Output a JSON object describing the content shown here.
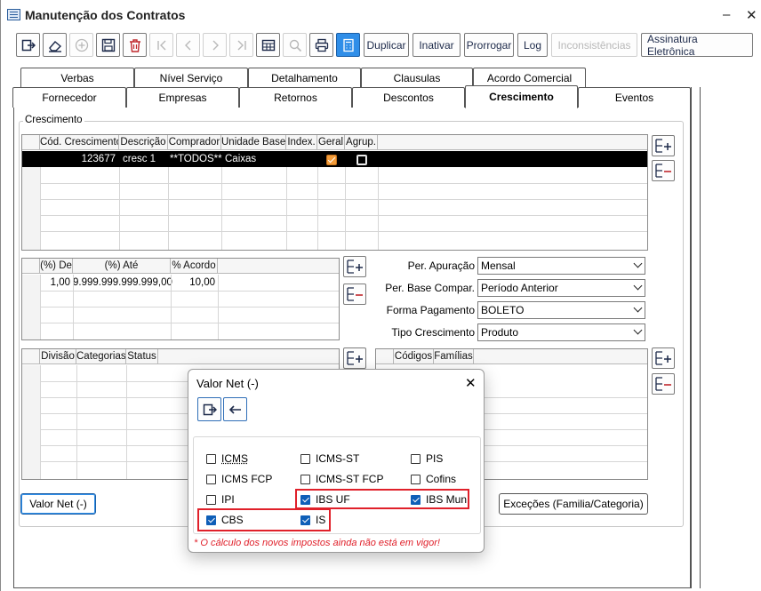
{
  "window": {
    "title": "Manutenção dos Contratos",
    "minimize": "–",
    "close": "✕"
  },
  "toolbar": {
    "buttons": [
      "Duplicar",
      "Inativar",
      "Prorrogar",
      "Log",
      "Inconsistências",
      "Assinatura Eletrônica"
    ]
  },
  "tabs_top": [
    "Verbas",
    "Nível Serviço",
    "Detalhamento",
    "Clausulas",
    "Acordo Comercial"
  ],
  "tabs_bottom": [
    "Fornecedor",
    "Empresas",
    "Retornos",
    "Descontos",
    "Crescimento",
    "Eventos"
  ],
  "crescimento": {
    "group_label": "Crescimento",
    "columns": [
      "Cód. Crescimento",
      "Descrição",
      "Comprador",
      "Unidade Base",
      "Index.",
      "Geral",
      "Agrup."
    ],
    "row": {
      "codigo": "123677",
      "descricao": "cresc 1",
      "comprador": "**TODOS**",
      "unidade": "Caixas"
    }
  },
  "faixas": {
    "columns": [
      "(%) De",
      "(%) Até",
      "% Acordo"
    ],
    "row": {
      "de": "1,00",
      "ate": "9.999.999.999.999,00",
      "acordo": "10,00"
    }
  },
  "form": {
    "per_apuracao_label": "Per. Apuração",
    "per_apuracao": "Mensal",
    "per_base_label": "Per. Base Compar.",
    "per_base": "Período Anterior",
    "forma_pgto_label": "Forma Pagamento",
    "forma_pgto": "BOLETO",
    "tipo_cresc_label": "Tipo Crescimento",
    "tipo_cresc": "Produto"
  },
  "divisao": {
    "columns": [
      "Divisão",
      "Categorias",
      "Status"
    ]
  },
  "familias": {
    "columns": [
      "Códigos",
      "Famílias"
    ]
  },
  "buttons": {
    "valor_net": "Valor Net (-)",
    "excecoes": "Exceções (Familia/Categoria)"
  },
  "dialog": {
    "title": "Valor Net (-)",
    "close": "✕",
    "options": [
      {
        "label": "ICMS",
        "checked": false
      },
      {
        "label": "ICMS-ST",
        "checked": false
      },
      {
        "label": "PIS",
        "checked": false
      },
      {
        "label": "ICMS FCP",
        "checked": false
      },
      {
        "label": "ICMS-ST FCP",
        "checked": false
      },
      {
        "label": "Cofins",
        "checked": false
      },
      {
        "label": "IPI",
        "checked": false
      },
      {
        "label": "IBS UF",
        "checked": true
      },
      {
        "label": "IBS Mun",
        "checked": true
      },
      {
        "label": "CBS",
        "checked": true
      },
      {
        "label": "IS",
        "checked": true
      }
    ],
    "warning": "* O cálculo dos novos impostos ainda não está em vigor!"
  },
  "colors": {
    "accent": "#2f8ee8",
    "highlight": "#e0202a",
    "warning_text": "#e0202a",
    "check_orange": "#f39c3a"
  }
}
